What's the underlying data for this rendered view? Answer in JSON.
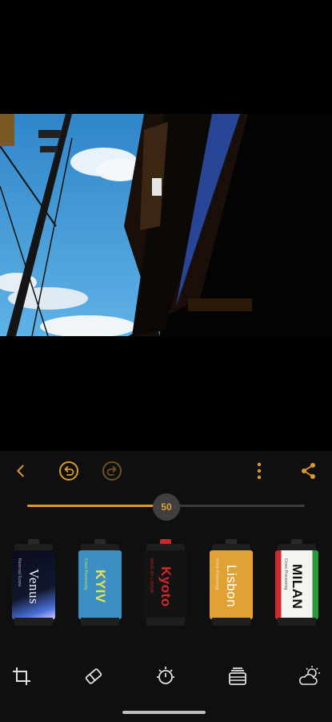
{
  "toolbar": {
    "back_icon": "chevron-left-icon",
    "undo_icon": "undo-icon",
    "redo_icon": "redo-icon",
    "more_icon": "more-vertical-icon",
    "share_icon": "share-icon",
    "accent": "#d99a2b"
  },
  "slider": {
    "value": "50",
    "fraction": 0.5
  },
  "films": [
    {
      "name": "Venus",
      "sub": "Reversal Scans",
      "theme": "venus"
    },
    {
      "name": "KYIV",
      "sub": "Cross Processing",
      "theme": "kyiv"
    },
    {
      "name": "Kyoto",
      "sub": "MADE BY LUMIUM",
      "theme": "kyoto"
    },
    {
      "name": "Lisbon",
      "sub": "Cross Processing",
      "theme": "lisbon"
    },
    {
      "name": "MILAN",
      "sub": "Cross Processing",
      "theme": "milan"
    }
  ],
  "tools": [
    {
      "icon": "crop-icon"
    },
    {
      "icon": "eraser-icon"
    },
    {
      "icon": "exposure-timer-icon"
    },
    {
      "icon": "film-presets-icon"
    },
    {
      "icon": "weather-icon"
    }
  ]
}
